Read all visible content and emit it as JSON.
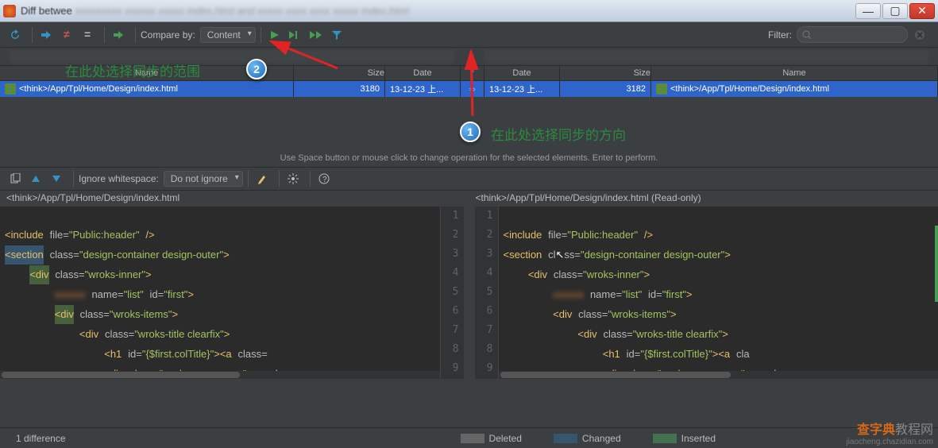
{
  "window": {
    "title": "Diff betwee"
  },
  "toolbar1": {
    "compare_label": "Compare by:",
    "compare_value": "Content",
    "filter_label": "Filter:"
  },
  "annotations": {
    "bubble1": "1",
    "bubble2": "2",
    "text_top": "在此处选择同步的范围",
    "text_mid": "在此处选择同步的方向"
  },
  "columns": {
    "name": "Name",
    "size": "Size",
    "date": "Date",
    "act": "*"
  },
  "row": {
    "left_name": "<think>/App/Tpl/Home/Design/index.html",
    "left_size": "3180",
    "left_date": "13-12-23 上...",
    "act": "⇒",
    "right_date": "13-12-23 上...",
    "right_size": "3182",
    "right_name": "<think>/App/Tpl/Home/Design/index.html"
  },
  "hint": "Use Space button or mouse click to change operation for the selected elements. Enter to perform.",
  "toolbar2": {
    "ignore_label": "Ignore whitespace:",
    "ignore_value": "Do not ignore"
  },
  "paths": {
    "left": "<think>/App/Tpl/Home/Design/index.html",
    "right": "<think>/App/Tpl/Home/Design/index.html (Read-only)"
  },
  "linenums": [
    "1",
    "2",
    "3",
    "4",
    "5",
    "6",
    "7",
    "8",
    "9"
  ],
  "status": {
    "diff": "1 difference",
    "deleted": "Deleted",
    "changed": "Changed",
    "inserted": "Inserted"
  },
  "watermark": {
    "a": "查字典",
    "b": "教程网",
    "c": "jiaocheng.chazidian.com"
  }
}
